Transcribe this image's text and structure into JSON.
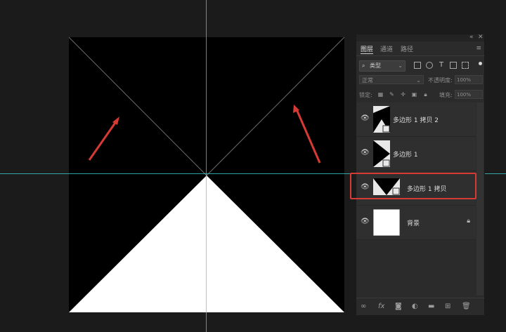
{
  "panel": {
    "top_controls": {
      "collapse": "«",
      "close": "✕"
    },
    "tabs": [
      {
        "label": "图层",
        "active": true
      },
      {
        "label": "通道",
        "active": false
      },
      {
        "label": "路径",
        "active": false
      }
    ],
    "menu_icon": "≡",
    "filter": {
      "icon": "search-icon",
      "label": "类型",
      "chevron": "⌄"
    },
    "blend_mode": "正常",
    "opacity_label": "不透明度:",
    "opacity_value": "100%",
    "lock_label": "锁定:",
    "fill_label": "填充:",
    "fill_value": "100%",
    "layers": [
      {
        "name": "多边形 1 拷贝 2",
        "visible": true
      },
      {
        "name": "多边形 1",
        "visible": true
      },
      {
        "name": "多边形 1 拷贝",
        "visible": true,
        "selected": true
      },
      {
        "name": "背景",
        "visible": true,
        "locked": true
      }
    ],
    "bottom_icons": [
      "link-icon",
      "fx-icon",
      "mask-icon",
      "adjustment-icon",
      "folder-icon",
      "new-layer-icon",
      "trash-icon"
    ]
  },
  "colors": {
    "accent_red": "#d63a34",
    "guide_cyan": "#3fd6d6",
    "canvas_bg": "#1b1b1b",
    "panel_bg": "#2b2b2b"
  },
  "icons": {
    "eye": "eye-icon",
    "lock": "lock-icon"
  }
}
